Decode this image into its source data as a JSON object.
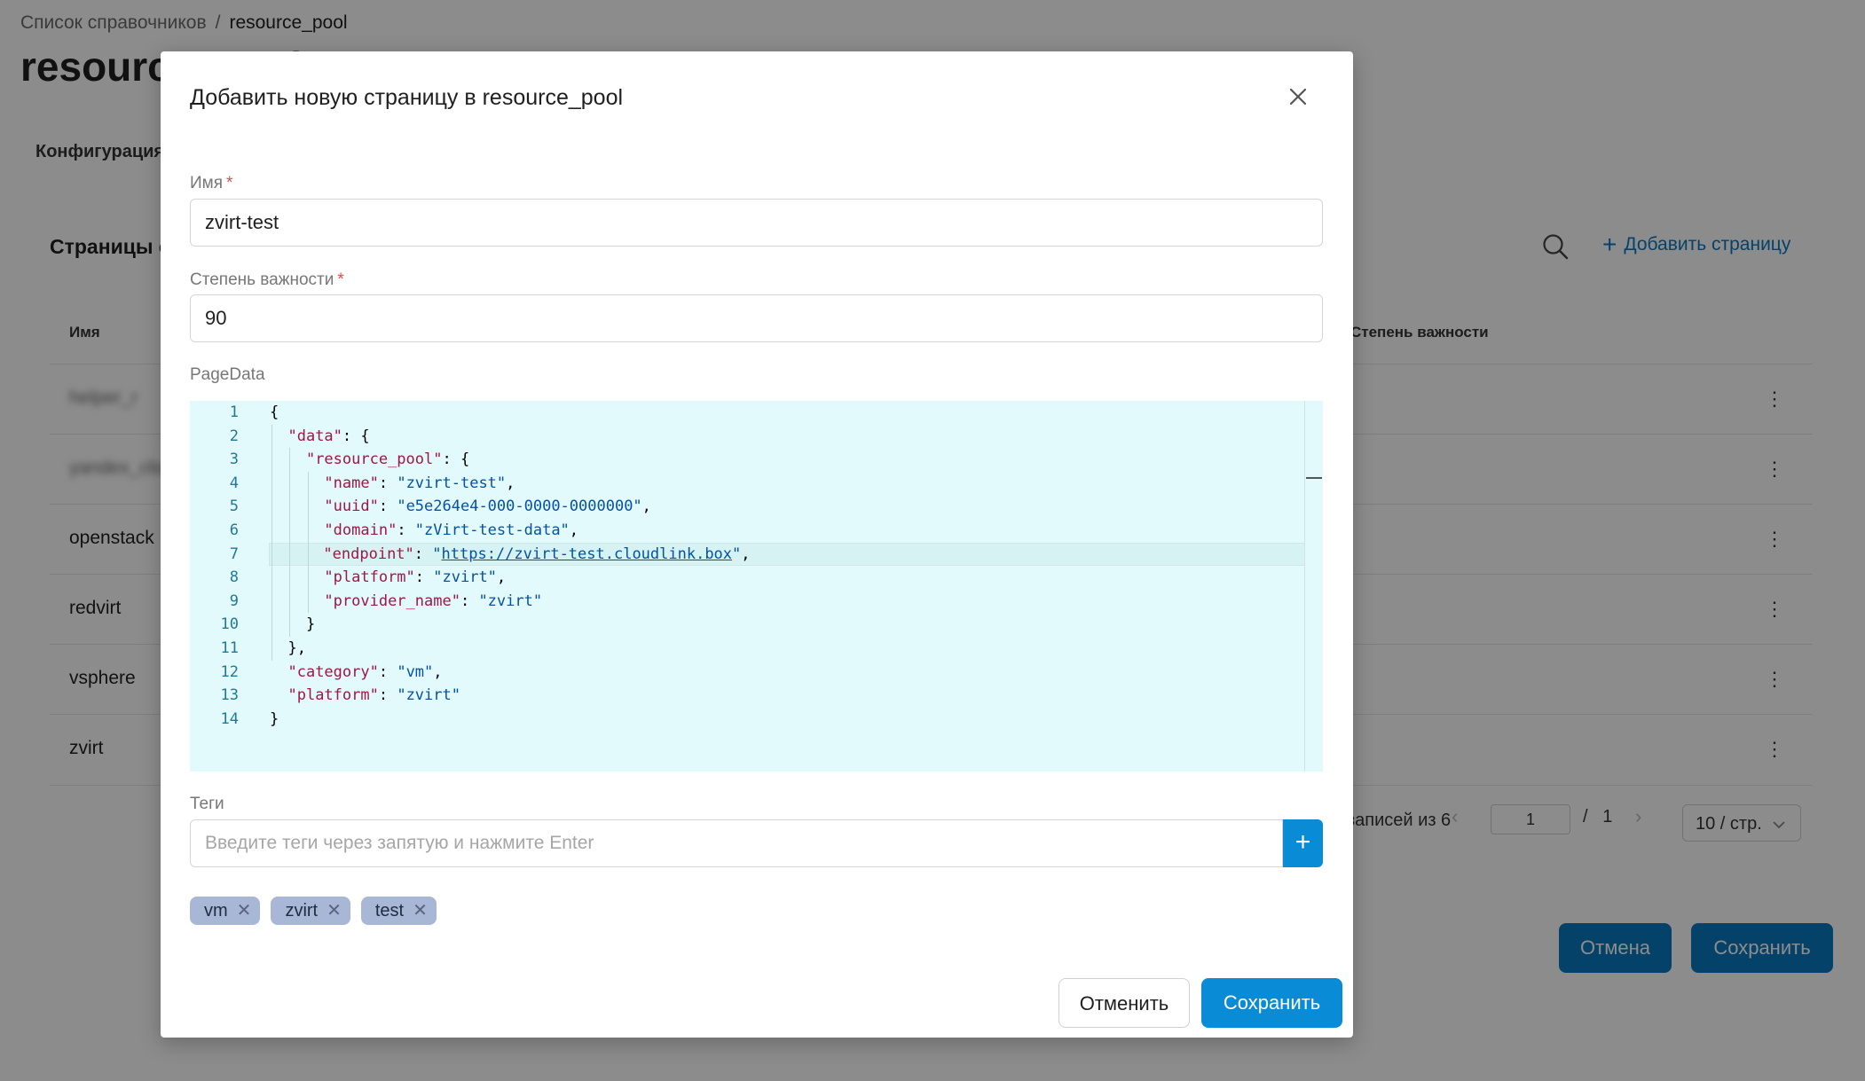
{
  "background": {
    "breadcrumb": {
      "root": "Список справочников",
      "separator": "/",
      "current": "resource_pool"
    },
    "page_title": "resource_pool",
    "tab": "Конфигурация",
    "section_title": "Страницы справочника",
    "add_page_label": "Добавить страницу",
    "table": {
      "headers": {
        "name": "Имя",
        "importance": "Степень важности"
      },
      "rows": [
        {
          "name": "helper_r"
        },
        {
          "name": "yandex_cloud"
        },
        {
          "name": "openstack"
        },
        {
          "name": "redvirt"
        },
        {
          "name": "vsphere"
        },
        {
          "name": "zvirt"
        }
      ],
      "kebab": "⋮"
    },
    "pagination": {
      "summary": "записей из 6",
      "prev": "‹",
      "current_page": "1",
      "separator": "/",
      "total_pages": "1",
      "next": "›",
      "page_size": "10 / стр."
    },
    "cancel_label": "Отмена",
    "save_label": "Сохранить"
  },
  "modal": {
    "title": "Добавить новую страницу в resource_pool",
    "fields": {
      "name": {
        "label": "Имя",
        "required_mark": "*",
        "value": "zvirt-test"
      },
      "importance": {
        "label": "Степень важности",
        "required_mark": "*",
        "value": "90"
      },
      "page_data": {
        "label": "PageData"
      },
      "tags": {
        "label": "Теги",
        "placeholder": "Введите теги через запятую и нажмите Enter",
        "add_symbol": "+"
      }
    },
    "code_lines": [
      "{",
      "  \"data\": {",
      "    \"resource_pool\": {",
      "      \"name\": \"zvirt-test\",",
      "      \"uuid\": \"e5e264e4-000-0000-0000000\",",
      "      \"domain\": \"zVirt-test-data\",",
      "      \"endpoint\": \"https://zvirt-test.cloudlink.box\",",
      "      \"platform\": \"zvirt\",",
      "      \"provider_name\": \"zvirt\"",
      "    }",
      "  },",
      "  \"category\": \"vm\",",
      "  \"platform\": \"zvirt\"",
      "}"
    ],
    "active_line": 7,
    "tags": [
      "vm",
      "zvirt",
      "test"
    ],
    "cancel_label": "Отменить",
    "save_label": "Сохранить"
  },
  "colors": {
    "accent": "#0a8bd6",
    "editor_bg": "#e2fafb",
    "json_key": "#a31545",
    "json_string": "#0451a5",
    "line_number": "#237893",
    "chip_bg": "#a9b7d6",
    "required": "#e24b4b"
  },
  "icons": {
    "close": "close-icon",
    "search": "search-icon",
    "plus": "plus-icon",
    "chip_remove": "close-small-icon",
    "kebab": "more-vertical-icon",
    "chevron_down": "chevron-down-icon"
  }
}
